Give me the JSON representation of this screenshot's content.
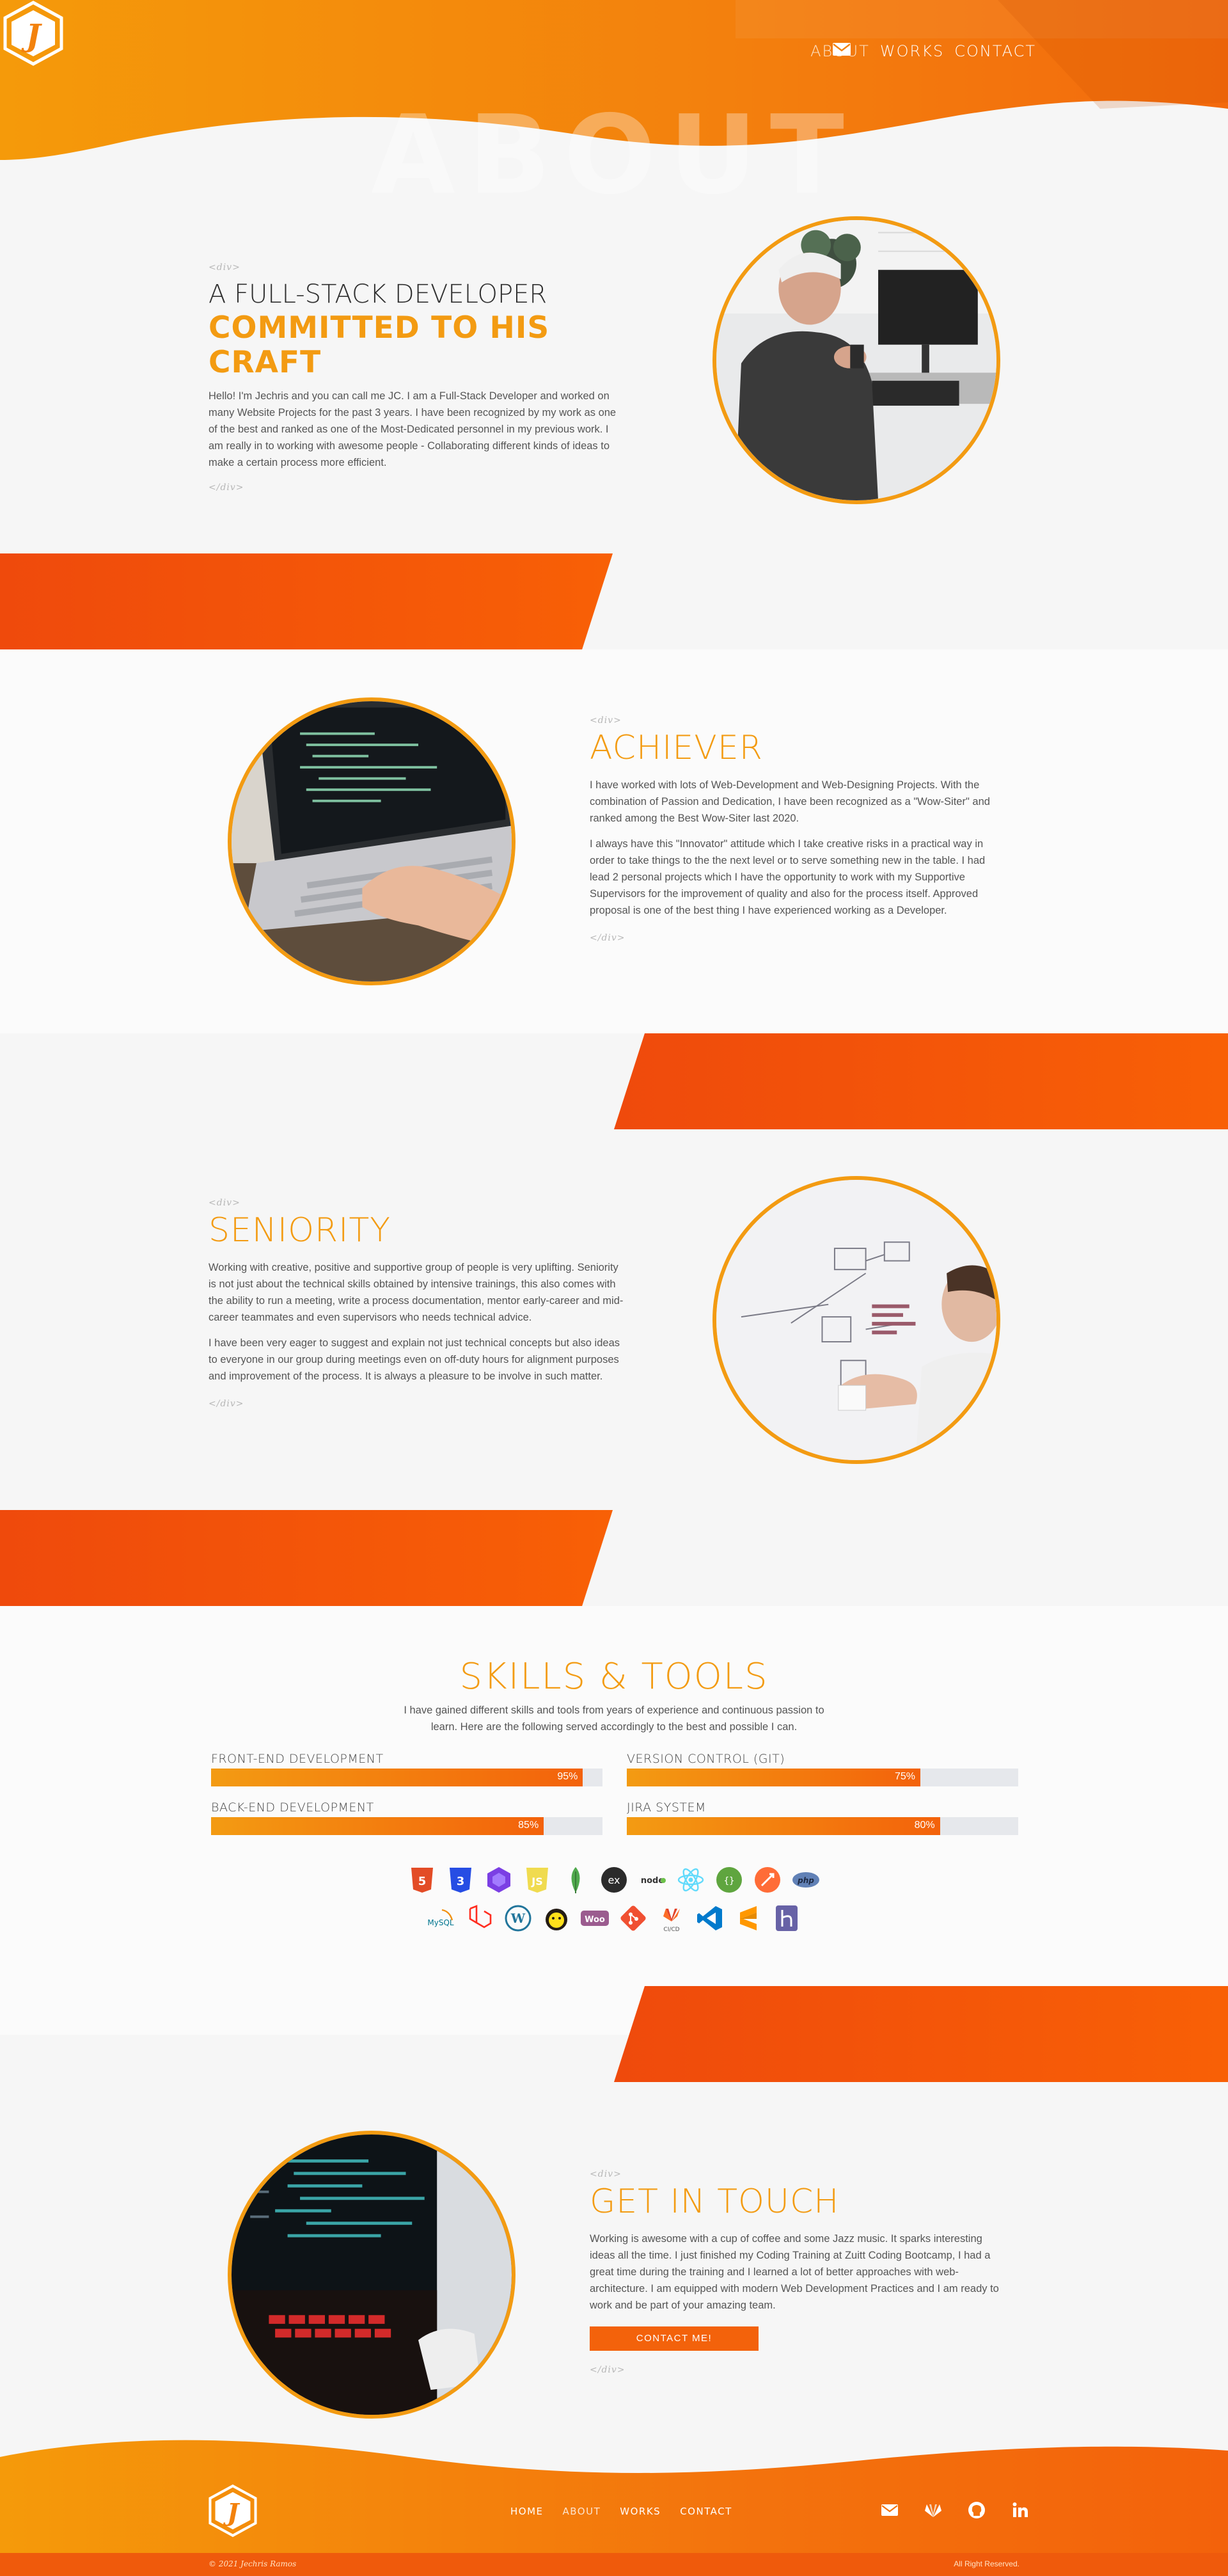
{
  "nav": {
    "items": [
      "ABOUT",
      "WORKS",
      "CONTACT"
    ],
    "active": "ABOUT",
    "mail_icon": "envelope-icon"
  },
  "hero": {
    "title": "ABOUT"
  },
  "intro": {
    "open_tag": "<div>",
    "line1": "A FULL-STACK DEVELOPER",
    "line2": "COMMITTED TO HIS CRAFT",
    "text": "Hello! I'm Jechris and you can call me JC. I am a Full-Stack Developer and worked on many Website Projects for the past 3 years. I have been recognized by my work as one of the best and ranked as one of the Most-Dedicated personnel in my previous work. I am really in to working with awesome people - Collaborating different kinds of ideas to make a certain process more efficient.",
    "close_tag": "</div>"
  },
  "achiever": {
    "open_tag": "<div>",
    "title": "ACHIEVER",
    "p1": "I have worked with lots of Web-Development and Web-Designing Projects. With the combination of Passion and Dedication, I have been recognized as a \"Wow-Siter\" and ranked among the Best Wow-Siter last 2020.",
    "p2": "I always have this \"Innovator\" attitude which I take creative risks in a practical way in order to take things to the the next level or to serve something new in the table. I had lead 2 personal projects which I have the opportunity to work with my Supportive Supervisors for the improvement of quality and also for the process itself. Approved proposal is one of the best thing I have experienced working as a Developer.",
    "close_tag": "</div>"
  },
  "seniority": {
    "open_tag": "<div>",
    "title": "SENIORITY",
    "p1": "Working with creative, positive and supportive group of people is very uplifting. Seniority is not just about the technical skills obtained by intensive trainings, this also comes with the ability to run a meeting, write a process documentation, mentor early-career and mid-career teammates and even supervisors who needs technical advice.",
    "p2": "I have been very eager to suggest and explain not just technical concepts but also ideas to everyone in our group during meetings even on off-duty hours for alignment purposes and improvement of the process. It is always a pleasure to be involve in such matter.",
    "close_tag": "</div>"
  },
  "skills": {
    "title": "SKILLS & TOOLS",
    "desc": "I have gained different skills and tools from years of experience and continuous passion to learn. Here are the following served accordingly to the best and possible I can.",
    "bars": [
      {
        "label": "FRONT-END DEVELOPMENT",
        "value": 95,
        "text": "95%"
      },
      {
        "label": "VERSION CONTROL (GIT)",
        "value": 75,
        "text": "75%"
      },
      {
        "label": "BACK-END DEVELOPMENT",
        "value": 85,
        "text": "85%"
      },
      {
        "label": "JIRA SYSTEM",
        "value": 80,
        "text": "80%"
      }
    ],
    "icons_row1": [
      "html5-icon",
      "css3-icon",
      "bootstrap-icon",
      "javascript-icon",
      "mongodb-icon",
      "express-icon",
      "nodejs-icon",
      "react-icon",
      "graphql-icon",
      "postman-icon",
      "php-icon"
    ],
    "icons_row2": [
      "mysql-icon",
      "laravel-icon",
      "wordpress-icon",
      "mailchimp-icon",
      "woocommerce-icon",
      "git-icon",
      "gitlab-cicd-icon",
      "vscode-icon",
      "sublime-icon",
      "heroku-icon"
    ],
    "icon_texts": {
      "express": "ex",
      "node": "node",
      "php": "php",
      "mysql": "MySQL",
      "woo": "Woo",
      "cicd": "CI/CD"
    }
  },
  "contact": {
    "open_tag": "<div>",
    "title": "GET IN TOUCH",
    "text": "Working is awesome with a cup of coffee and some Jazz music. It sparks interesting ideas all the time. I just finished my Coding Training at Zuitt Coding Bootcamp, I had a great time during the training and I learned a lot of better approaches with web-architecture. I am equipped with modern Web Development Practices and I am ready to work and be part of your amazing team.",
    "button": "CONTACT ME!",
    "close_tag": "</div>"
  },
  "footer": {
    "nav": [
      "HOME",
      "ABOUT",
      "WORKS",
      "CONTACT"
    ],
    "active": "ABOUT",
    "social": [
      "envelope-icon",
      "gitlab-icon",
      "github-icon",
      "linkedin-icon"
    ],
    "copyright": "© 2021 Jechris Ramos",
    "rights": "All Right Reserved."
  },
  "colors": {
    "accent": "#f39b12",
    "deep": "#f3620b",
    "stripe": "#ef4a0c"
  }
}
